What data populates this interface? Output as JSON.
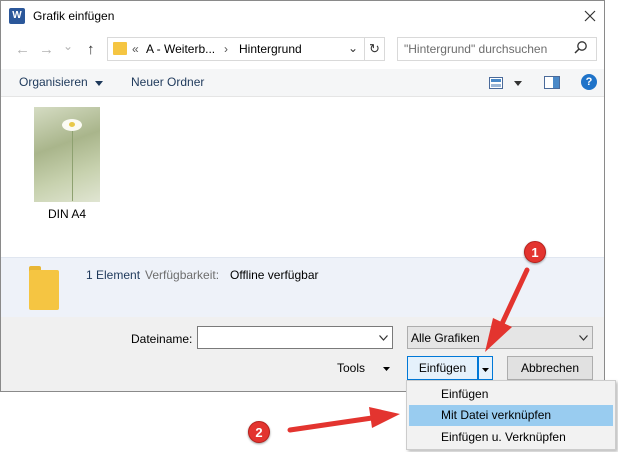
{
  "window": {
    "title": "Grafik einfügen",
    "app_icon": "W"
  },
  "nav": {
    "back_icon": "←",
    "forward_icon": "→",
    "recent_icon": "⌄",
    "up_icon": "↑",
    "breadcrumb_prefix": "«",
    "breadcrumb": [
      "A - Weiterb...",
      "Hintergrund"
    ],
    "breadcrumb_sep": "›",
    "address_dropdown": "⌄",
    "refresh_icon": "↻",
    "search_placeholder": "\"Hintergrund\" durchsuchen",
    "search_icon": "⌕"
  },
  "toolbar": {
    "organize_label": "Organisieren",
    "new_folder_label": "Neuer Ordner",
    "help_icon": "?"
  },
  "files": [
    {
      "name": "DIN A4"
    }
  ],
  "details": {
    "count": "1 Element",
    "availability_label": "Verfügbarkeit:",
    "availability_value": "Offline verfügbar"
  },
  "form": {
    "filename_label": "Dateiname:",
    "filename_value": "",
    "filetype_value": "Alle Grafiken",
    "tools_label": "Tools",
    "insert_label": "Einfügen",
    "cancel_label": "Abbrechen"
  },
  "insert_menu": {
    "items": [
      "Einfügen",
      "Mit Datei verknüpfen",
      "Einfügen u. Verknüpfen"
    ],
    "highlighted_index": 1
  },
  "annotations": {
    "badge_1": "1",
    "badge_2": "2",
    "color": "#e3342f"
  }
}
